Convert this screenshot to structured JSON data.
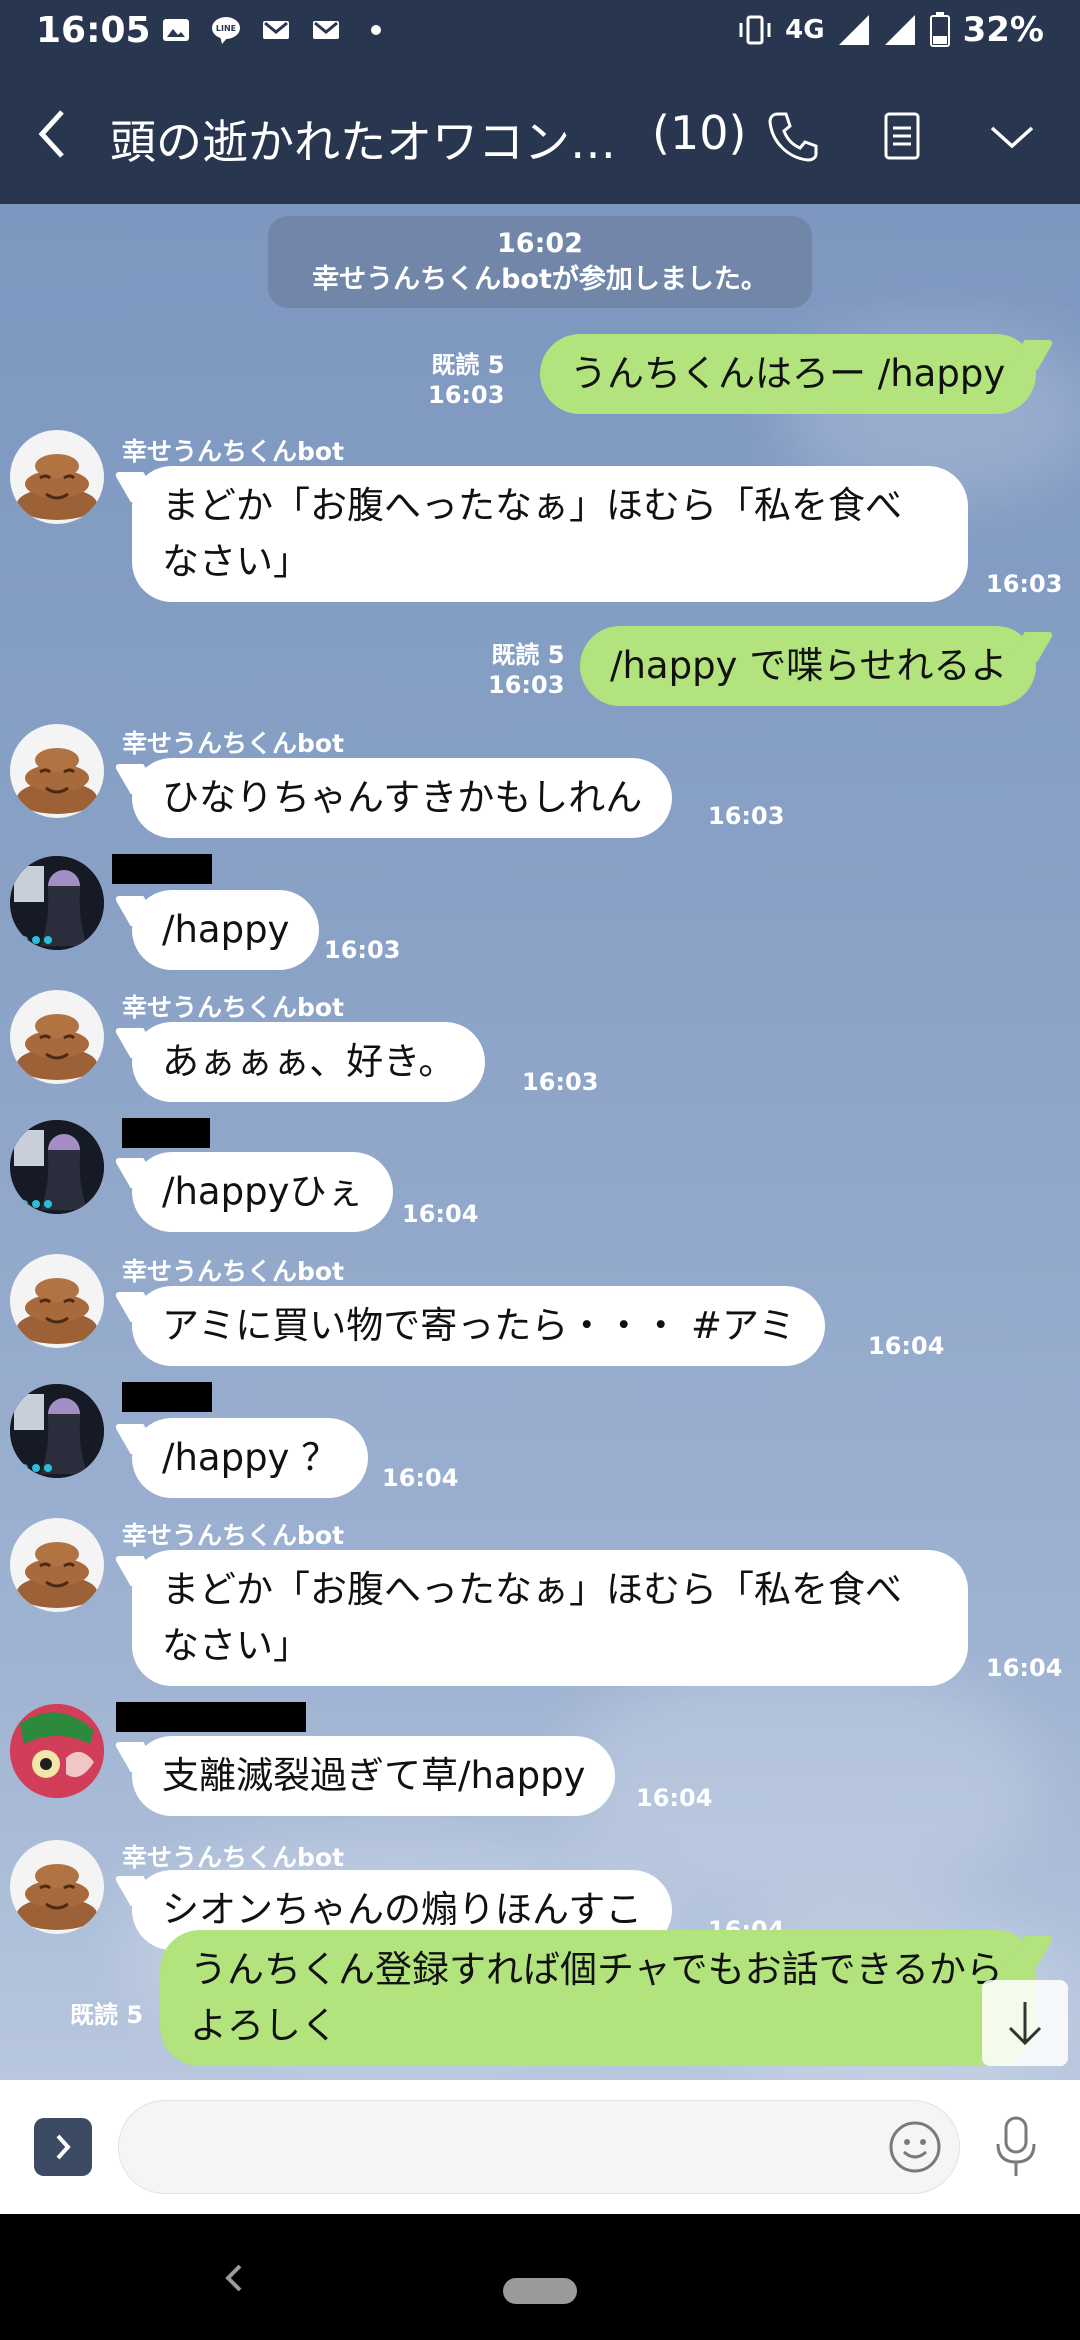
{
  "status_bar": {
    "time": "16:05",
    "notification_icons": [
      "image-icon",
      "line-icon",
      "gmail-icon",
      "gmail-icon",
      "dot-icon"
    ],
    "network": "4G",
    "battery": "32%"
  },
  "header": {
    "title": "頭の逝かれたオワコン…",
    "member_count": "(10)",
    "icons": [
      "back-icon",
      "phone-icon",
      "notes-icon",
      "chevron-down-icon"
    ]
  },
  "system_message": {
    "time": "16:02",
    "text": "幸せうんちくんbotが参加しました。"
  },
  "messages": [
    {
      "dir": "out",
      "text": "うんちくんはろー /happy",
      "read": "既読 5",
      "time": "16:03"
    },
    {
      "dir": "in",
      "sender": "幸せうんちくんbot",
      "avatar": "poop-avatar",
      "text": "まどか「お腹へったなぁ」ほむら「私を食べなさい」",
      "time": "16:03"
    },
    {
      "dir": "out",
      "text": "/happy で喋らせれるよ",
      "read": "既読 5",
      "time": "16:03"
    },
    {
      "dir": "in",
      "sender": "幸せうんちくんbot",
      "avatar": "poop-avatar",
      "text": "ひなりちゃんすきかもしれん",
      "time": "16:03"
    },
    {
      "dir": "in",
      "sender": "",
      "avatar": "user-avatar",
      "text": "/happy",
      "time": "16:03"
    },
    {
      "dir": "in",
      "sender": "幸せうんちくんbot",
      "avatar": "poop-avatar",
      "text": "あぁぁぁ、好き。",
      "time": "16:03"
    },
    {
      "dir": "in",
      "sender": "",
      "avatar": "user-avatar",
      "text": "/happyひぇ",
      "time": "16:04"
    },
    {
      "dir": "in",
      "sender": "幸せうんちくんbot",
      "avatar": "poop-avatar",
      "text": "アミに買い物で寄ったら・・・ #アミ",
      "time": "16:04"
    },
    {
      "dir": "in",
      "sender": "",
      "avatar": "user-avatar",
      "text": "/happy ？",
      "time": "16:04"
    },
    {
      "dir": "in",
      "sender": "幸せうんちくんbot",
      "avatar": "poop-avatar",
      "text": "まどか「お腹へったなぁ」ほむら「私を食べなさい」",
      "time": "16:04"
    },
    {
      "dir": "in",
      "sender": "",
      "avatar": "user2-avatar",
      "text": "支離滅裂過ぎて草/happy",
      "time": "16:04"
    },
    {
      "dir": "in",
      "sender": "幸せうんちくんbot",
      "avatar": "poop-avatar",
      "text": "シオンちゃんの煽りほんすこ",
      "time": "16:04"
    },
    {
      "dir": "out",
      "text": "うんちくん登録すれば個チャでもお話できるからよろしく",
      "read": "既読 5",
      "time": ""
    }
  ],
  "input": {
    "placeholder": ""
  },
  "colors": {
    "header_bg": "#29364f",
    "chat_bg": "#8aa2c6",
    "outgoing_bubble": "#b2e37c",
    "incoming_bubble": "#ffffff"
  }
}
